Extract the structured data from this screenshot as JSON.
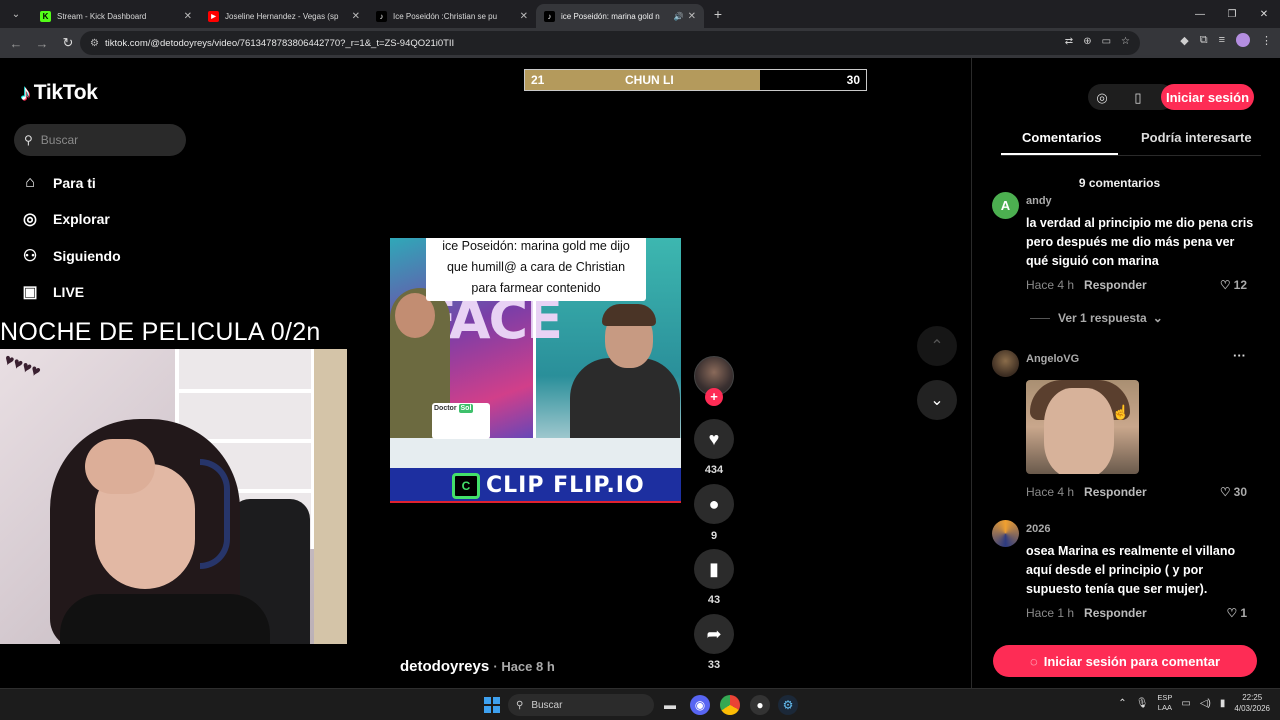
{
  "browser": {
    "tabs": [
      {
        "title": "Stream - Kick Dashboard",
        "favicon": "K",
        "fav_color": "#53fc18"
      },
      {
        "title": "Joseline Hernandez - Vegas (sp",
        "favicon": "▶",
        "fav_color": "#ff0000"
      },
      {
        "title": "Ice Poseidón :Christian se pu",
        "favicon": "♪",
        "fav_color": "#ffffff"
      },
      {
        "title": "ice Poseidón: marina gold n",
        "favicon": "♪",
        "fav_color": "#ffffff",
        "active": true
      }
    ],
    "url": "tiktok.com/@detodoyreys/video/7613478783806442770?_r=1&_t=ZS-94QO21i0TII"
  },
  "sidebar": {
    "logo_text": "TikTok",
    "search_placeholder": "Buscar",
    "items": [
      {
        "label": "Para ti",
        "icon": "home-icon"
      },
      {
        "label": "Explorar",
        "icon": "compass-icon"
      },
      {
        "label": "Siguiendo",
        "icon": "following-icon"
      },
      {
        "label": "LIVE",
        "icon": "live-icon"
      }
    ]
  },
  "overlay": {
    "title": "NOCHE DE PELICULA 0/2n"
  },
  "scoreboard": {
    "left_value": "21",
    "name": "CHUN LI",
    "right_value": "30",
    "fill_fraction": 0.69,
    "fill_color": "#b49a5c"
  },
  "video": {
    "caption_lines": [
      "ice Poseidón: marina gold me dijo",
      "que humill@ a cara de Christian",
      "para farmear contenido"
    ],
    "sponsor_text": "Doctor",
    "sponsor_tag": "Sol",
    "face_text": "FACE",
    "banner_text": "CLIP FLIP.IO",
    "banner_logo": "C"
  },
  "actions": {
    "likes": "434",
    "comments": "9",
    "saves": "43",
    "shares": "33"
  },
  "author": {
    "username": "detodoyreys",
    "time": "· Hace 8 h"
  },
  "right_panel": {
    "login_label": "Iniciar sesión",
    "tabs": [
      "Comentarios",
      "Podría interesarte"
    ],
    "comment_count": "9 comentarios",
    "comments": [
      {
        "user": "andy",
        "avatar_letter": "A",
        "avatar_color": "#4caf50",
        "text": "la verdad al principio me dio pena cris pero después me dio más pena ver qué siguió con marina",
        "time": "Hace 4 h",
        "reply": "Responder",
        "likes": "12",
        "replies": "Ver 1 respuesta"
      },
      {
        "user": "AngeloVG",
        "time": "Hace 4 h",
        "reply": "Responder",
        "likes": "30"
      },
      {
        "user": "2026",
        "text": "osea Marina es realmente el villano aquí desde el principio ( y por supuesto tenía que ser mujer).",
        "time": "Hace 1 h",
        "reply": "Responder",
        "likes": "1"
      }
    ],
    "comment_button": "Iniciar sesión para comentar"
  },
  "taskbar": {
    "search_placeholder": "Buscar",
    "lang_top": "ESP",
    "lang_bottom": "LAA",
    "time": "22:25",
    "date": "4/03/2026"
  }
}
